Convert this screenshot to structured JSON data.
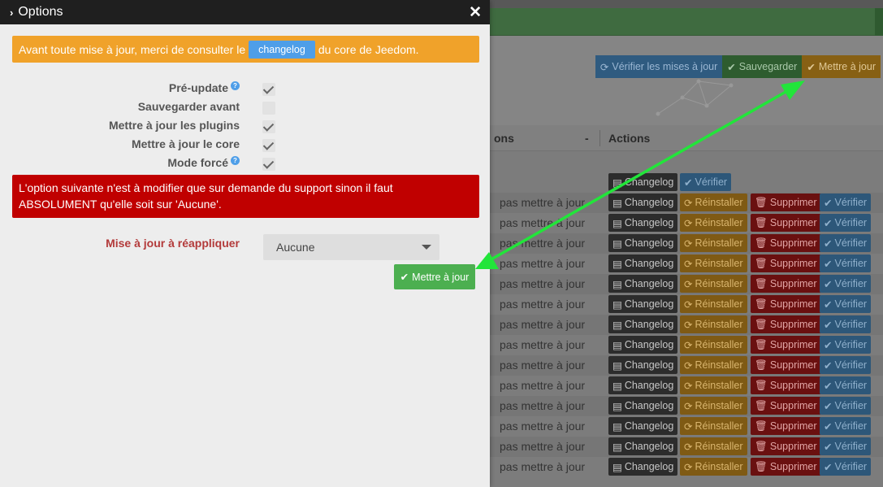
{
  "modal": {
    "title": "Options",
    "notice_before": "Avant toute mise à jour, merci de consulter le",
    "changelog_label": "changelog",
    "notice_after": "du core de Jeedom.",
    "options": [
      {
        "label": "Pré-update",
        "help": true,
        "checked": true
      },
      {
        "label": "Sauvegarder avant",
        "help": false,
        "checked": false
      },
      {
        "label": "Mettre à jour les plugins",
        "help": false,
        "checked": true
      },
      {
        "label": "Mettre à jour le core",
        "help": false,
        "checked": true
      },
      {
        "label": "Mode forcé",
        "help": true,
        "checked": true
      }
    ],
    "warning_line1": "L'option suivante n'est à modifier que sur demande du support sinon il faut",
    "warning_line2": "ABSOLUMENT qu'elle soit sur 'Aucune'.",
    "reapply_label": "Mise à jour à réappliquer",
    "reapply_selected": "Aucune",
    "submit_label": "Mettre à jour"
  },
  "background": {
    "toolbar": {
      "check_updates": "Vérifier les mises à jour",
      "save": "Sauvegarder",
      "update": "Mettre à jour"
    },
    "table": {
      "col_options": "ons",
      "col_dash": "-",
      "col_actions": "Actions",
      "row_text": "pas mettre à jour",
      "changelog": "Changelog",
      "reinstall": "Réinstaller",
      "delete": "Supprimer",
      "verify": "Vérifier"
    }
  },
  "colors": {
    "annotation_arrow": "#22e53a",
    "orange": "#f0a22a",
    "red": "#c00000",
    "green": "#4caf50",
    "blue": "#4e9ee8"
  }
}
